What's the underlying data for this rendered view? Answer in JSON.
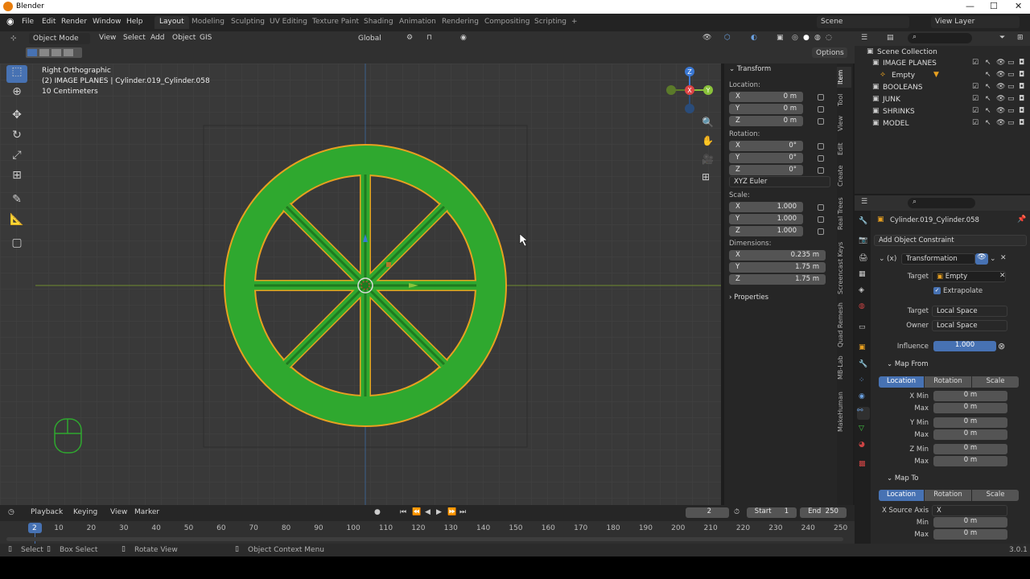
{
  "titlebar": {
    "title": "Blender",
    "min": "—",
    "max": "☐",
    "close": "✕"
  },
  "menus": [
    "File",
    "Edit",
    "Render",
    "Window",
    "Help"
  ],
  "workspaces": [
    "Layout",
    "Modeling",
    "Sculpting",
    "UV Editing",
    "Texture Paint",
    "Shading",
    "Animation",
    "Rendering",
    "Compositing",
    "Scripting"
  ],
  "workspaces_add": "+",
  "scene": {
    "label": "Scene",
    "viewlayer": "View Layer"
  },
  "vpheader": {
    "mode": "Object Mode",
    "menu": [
      "View",
      "Select",
      "Add",
      "Object",
      "GIS"
    ],
    "orientation": "Global",
    "options": "Options"
  },
  "viewport": {
    "view_name": "Right Orthographic",
    "object_info": "(2) IMAGE PLANES | Cylinder.019_Cylinder.058",
    "scale_info": "10 Centimeters"
  },
  "gizmo": {
    "x": "X",
    "y": "Y",
    "z": "Z"
  },
  "npanel": {
    "title": "Transform",
    "location_label": "Location:",
    "location": [
      [
        "X",
        "0 m"
      ],
      [
        "Y",
        "0 m"
      ],
      [
        "Z",
        "0 m"
      ]
    ],
    "rotation_label": "Rotation:",
    "rotation": [
      [
        "X",
        "0°"
      ],
      [
        "Y",
        "0°"
      ],
      [
        "Z",
        "0°"
      ]
    ],
    "rotation_mode": "XYZ Euler",
    "scale_label": "Scale:",
    "scale": [
      [
        "X",
        "1.000"
      ],
      [
        "Y",
        "1.000"
      ],
      [
        "Z",
        "1.000"
      ]
    ],
    "dimensions_label": "Dimensions:",
    "dimensions": [
      [
        "X",
        "0.235 m"
      ],
      [
        "Y",
        "1.75 m"
      ],
      [
        "Z",
        "1.75 m"
      ]
    ],
    "properties": "Properties"
  },
  "sidetabs": [
    "Item",
    "Tool",
    "View",
    "Edit",
    "Create",
    "Real Trees",
    "Screencast Keys",
    "Quad Remesh",
    "MB-Lab",
    "MakeHuman"
  ],
  "outliner": {
    "root": "Scene Collection",
    "items": [
      {
        "name": "IMAGE PLANES",
        "indent": 0
      },
      {
        "name": "Empty",
        "indent": 1
      },
      {
        "name": "BOOLEANS",
        "indent": 0
      },
      {
        "name": "JUNK",
        "indent": 0
      },
      {
        "name": "SHRINKS",
        "indent": 0
      },
      {
        "name": "MODEL",
        "indent": 0
      }
    ]
  },
  "props": {
    "object": "Cylinder.019_Cylinder.058",
    "add_constraint": "Add Object Constraint",
    "constraint_name": "Transformation",
    "target_label": "Target",
    "target_value": "Empty",
    "extrapolate": "Extrapolate",
    "target_space_label": "Target",
    "target_space": "Local Space",
    "owner_space_label": "Owner",
    "owner_space": "Local Space",
    "influence_label": "Influence",
    "influence": "1.000",
    "influence_value": 1.0,
    "map_from": "Map From",
    "map_from_tabs": [
      "Location",
      "Rotation",
      "Scale"
    ],
    "map_from_rows": [
      [
        "X Min",
        "0 m"
      ],
      [
        "Max",
        "0 m"
      ],
      [
        "Y Min",
        "0 m"
      ],
      [
        "Max",
        "0 m"
      ],
      [
        "Z Min",
        "0 m"
      ],
      [
        "Max",
        "0 m"
      ]
    ],
    "map_to": "Map To",
    "map_to_tabs": [
      "Location",
      "Rotation",
      "Scale"
    ],
    "x_source_label": "X Source Axis",
    "x_source": "X",
    "map_to_rows": [
      [
        "Min",
        "0 m"
      ],
      [
        "Max",
        "0 m"
      ]
    ]
  },
  "timeline": {
    "menu": [
      "Playback",
      "Keying",
      "View",
      "Marker"
    ],
    "current": "2",
    "start_label": "Start",
    "start": "1",
    "end_label": "End",
    "end": "250",
    "ticks": [
      "2",
      "10",
      "20",
      "30",
      "40",
      "50",
      "60",
      "70",
      "80",
      "90",
      "100",
      "110",
      "120",
      "130",
      "140",
      "150",
      "160",
      "170",
      "180",
      "190",
      "200",
      "210",
      "220",
      "230",
      "240",
      "250"
    ]
  },
  "status": {
    "select": "Select",
    "box_select": "Box Select",
    "rotate_view": "Rotate View",
    "context_menu": "Object Context Menu",
    "version": "3.0.1"
  },
  "colors": {
    "accent": "#4772b3",
    "mesh": "#2fa82f",
    "outline": "#e8a020",
    "x_axis": "#d44",
    "y_axis": "#8ac23a",
    "z_axis": "#3a78d4"
  }
}
